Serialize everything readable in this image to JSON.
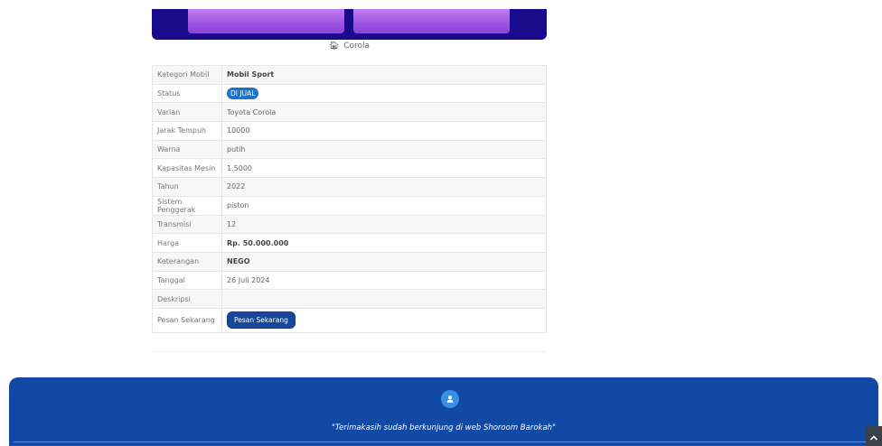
{
  "gallery": {
    "caption": "Corola",
    "caption_icon": "home-icon"
  },
  "details": {
    "rows": [
      {
        "label": "Kategori Mobil",
        "value": "Mobil Sport"
      },
      {
        "label": "Status",
        "value": "DI JUAL"
      },
      {
        "label": "Varian",
        "value": "Toyota Corola"
      },
      {
        "label": "Jarak Tempuh",
        "value": "10000"
      },
      {
        "label": "Warna",
        "value": "putih"
      },
      {
        "label": "Kapasitas Mesin",
        "value": "1.5000"
      },
      {
        "label": "Tahun",
        "value": "2022"
      },
      {
        "label": "Sistem Penggerak",
        "value": "piston"
      },
      {
        "label": "Transmisi",
        "value": "12"
      },
      {
        "label": "Harga",
        "value": "Rp. 50.000.000"
      },
      {
        "label": "Keterangan",
        "value": "NEGO"
      },
      {
        "label": "Tanggal",
        "value": "26 Juli 2024"
      },
      {
        "label": "Deskripsi",
        "value": ""
      },
      {
        "label": "Pesan Sekarang",
        "value": "Pesan Sekarang"
      }
    ]
  },
  "footer": {
    "icon": "user-icon",
    "message": "\"Terimakasih sudah berkunjung di web Shoroom Barokah\""
  },
  "scroll_top": {
    "icon": "chevron-up-icon"
  },
  "colors": {
    "banner": "#1a0a8c",
    "footer": "#1149a5",
    "badge": "#1a73c9",
    "button": "#16479a"
  }
}
